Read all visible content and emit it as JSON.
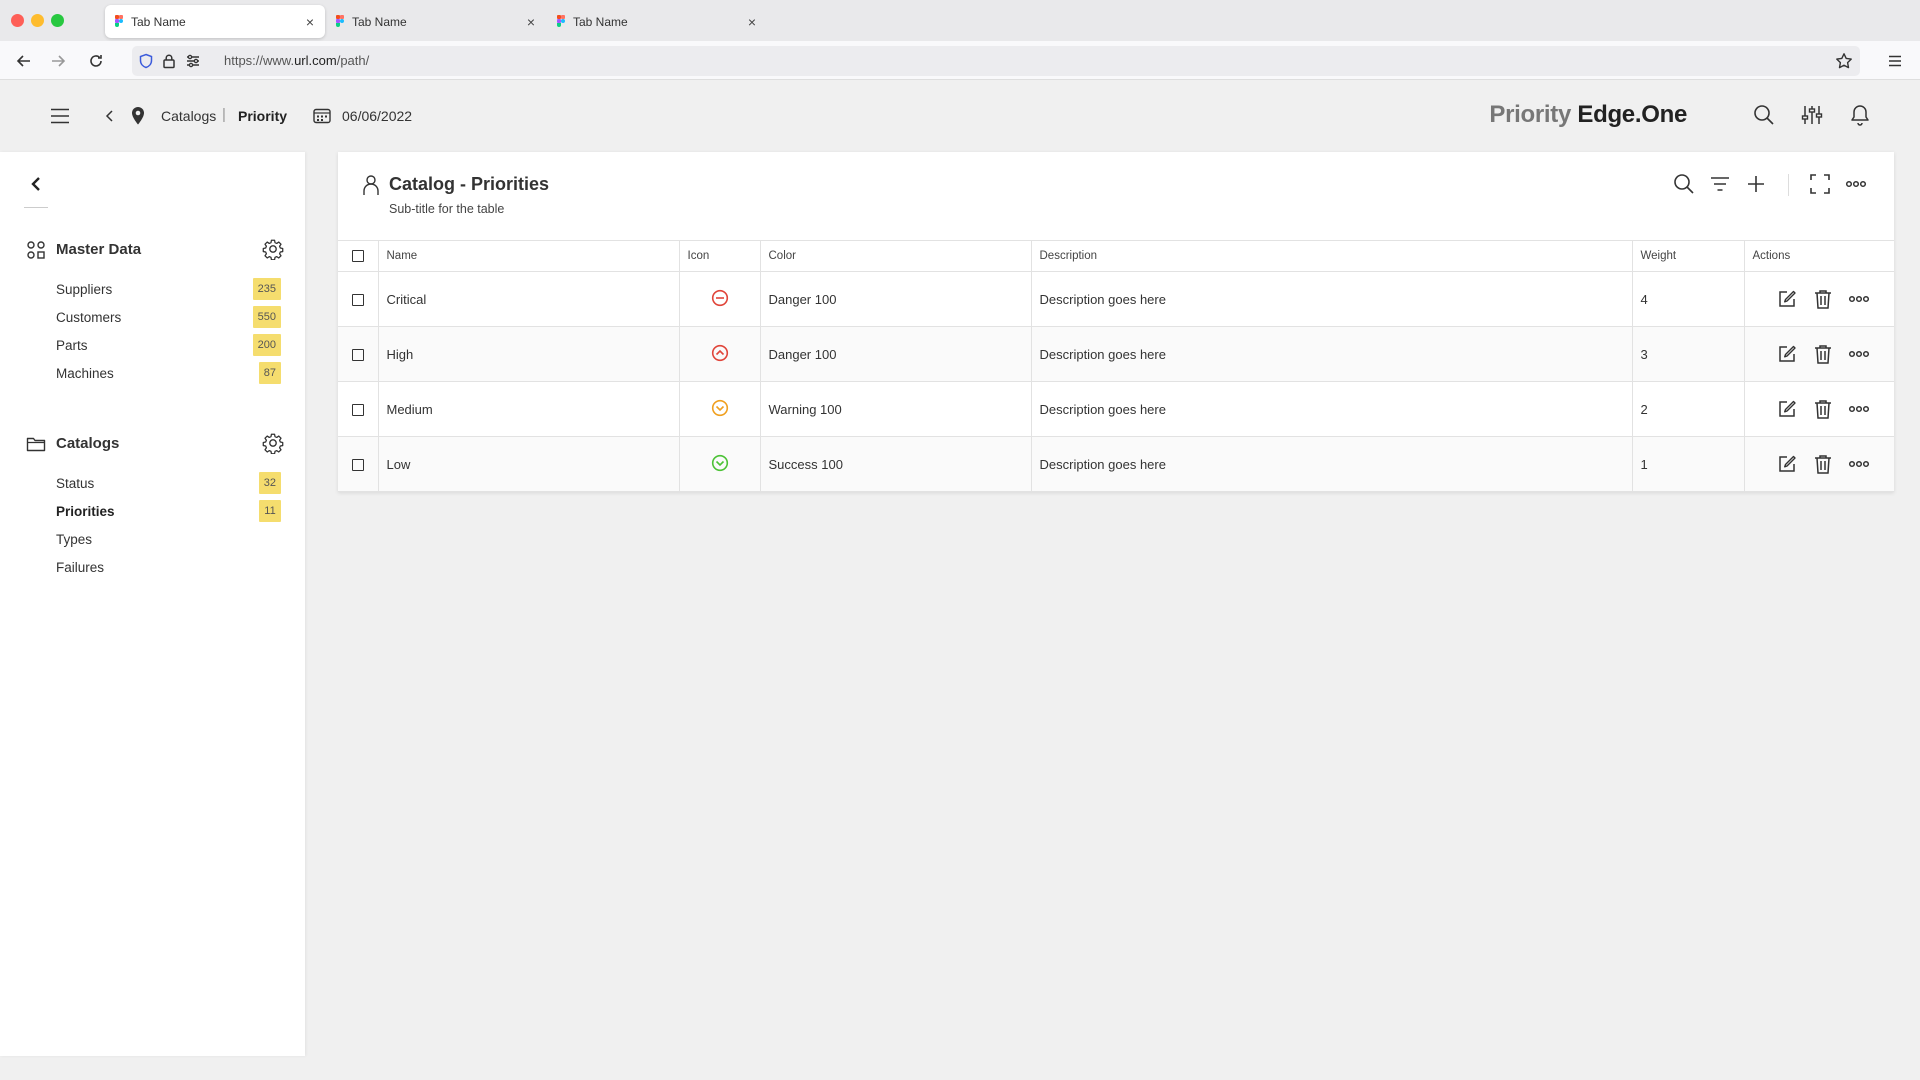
{
  "browser": {
    "tabs": [
      {
        "label": "Tab Name",
        "active": true
      },
      {
        "label": "Tab Name",
        "active": false
      },
      {
        "label": "Tab Name",
        "active": false
      }
    ],
    "tab_close_glyph": "×",
    "url_prefix": "https://www.",
    "url_domain": "url.com",
    "url_path": "/path/"
  },
  "header": {
    "breadcrumb": {
      "parent": "Catalogs",
      "separator": "|",
      "current": "Priority"
    },
    "date": "06/06/2022",
    "brand": {
      "part1": "Priority",
      "part2": "Edge.One"
    },
    "icons": [
      "menu-icon",
      "chevron-left-icon",
      "location-pin-icon",
      "calendar-icon",
      "search-icon",
      "sliders-icon",
      "bell-icon"
    ]
  },
  "sidebar": {
    "sections": [
      {
        "title": "Master Data",
        "icon": "grid-nodes-icon",
        "items": [
          {
            "label": "Suppliers",
            "count": "235"
          },
          {
            "label": "Customers",
            "count": "550"
          },
          {
            "label": "Parts",
            "count": "200"
          },
          {
            "label": "Machines",
            "count": "87"
          }
        ]
      },
      {
        "title": "Catalogs",
        "icon": "folder-icon",
        "items": [
          {
            "label": "Status",
            "count": "32"
          },
          {
            "label": "Priorities",
            "count": "11",
            "selected": true
          },
          {
            "label": "Types"
          },
          {
            "label": "Failures"
          }
        ]
      }
    ]
  },
  "card": {
    "title": "Catalog - Priorities",
    "subtitle": "Sub-title for the table",
    "columns": [
      "Name",
      "Icon",
      "Color",
      "Description",
      "Weight",
      "Actions"
    ],
    "rows": [
      {
        "name": "Critical",
        "icon": "minus-circle-icon",
        "icon_color": "#e0453a",
        "color": "Danger 100",
        "description": "Description goes here",
        "weight": "4"
      },
      {
        "name": "High",
        "icon": "chevron-up-circle-icon",
        "icon_color": "#e0453a",
        "color": "Danger 100",
        "description": "Description goes here",
        "weight": "3"
      },
      {
        "name": "Medium",
        "icon": "chevron-down-circle-icon",
        "icon_color": "#f0a020",
        "color": "Warning 100",
        "description": "Description goes here",
        "weight": "2"
      },
      {
        "name": "Low",
        "icon": "check-circle-icon",
        "icon_color": "#4cc236",
        "color": "Success 100",
        "description": "Description goes here",
        "weight": "1"
      }
    ]
  },
  "colors": {
    "badge": "#f5dd6e",
    "danger": "#e0453a",
    "warning": "#f0a020",
    "success": "#4cc236"
  }
}
